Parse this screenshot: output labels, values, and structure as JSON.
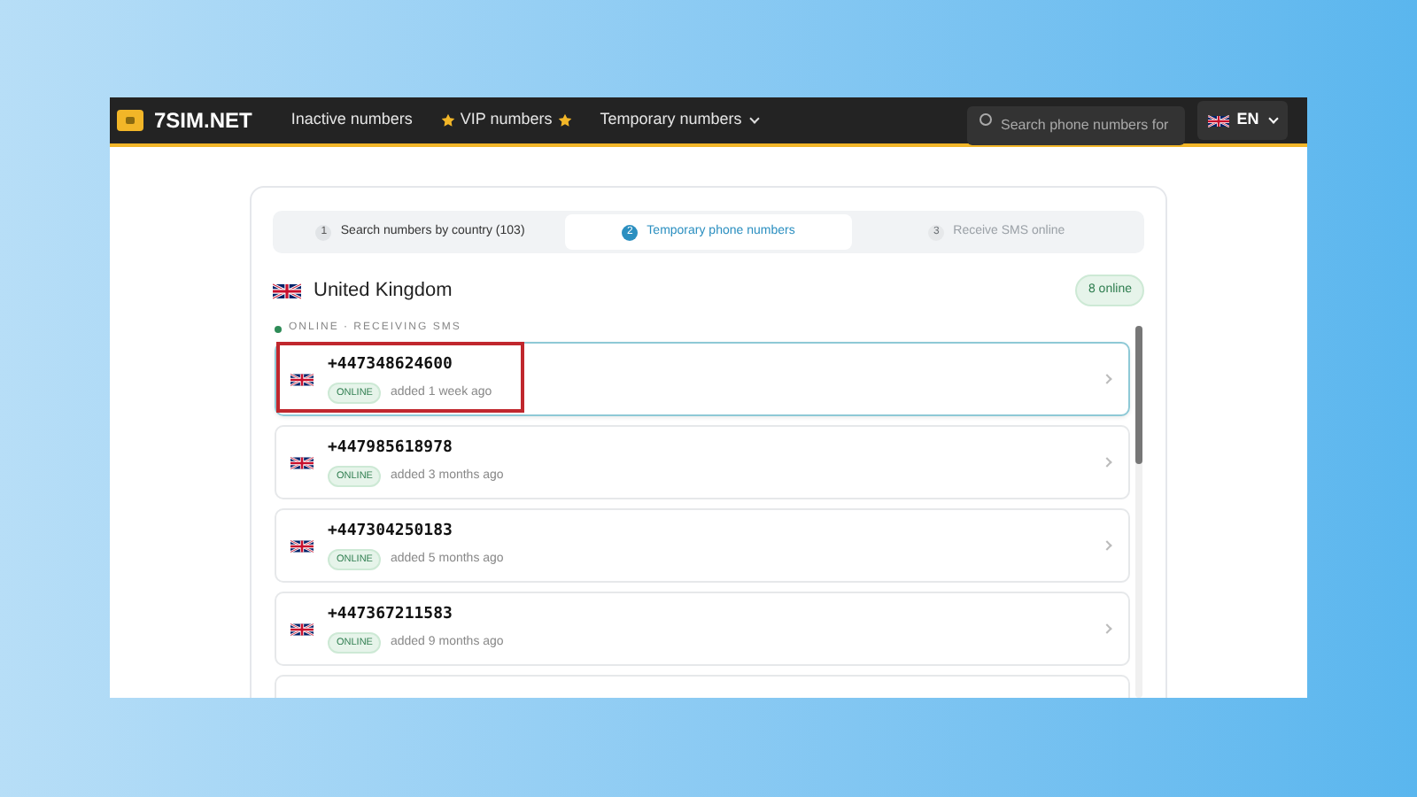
{
  "nav": {
    "logo": "7SIM.NET",
    "items": [
      {
        "label": "Inactive numbers",
        "kind": "plain"
      },
      {
        "label": "VIP numbers",
        "kind": "starred"
      },
      {
        "label": "Temporary numbers",
        "kind": "dropdown"
      }
    ],
    "search": {
      "placeholder": "Search phone numbers for"
    },
    "language": "EN"
  },
  "steps": [
    {
      "number": "1",
      "label": "Search numbers by country (103)",
      "selected": false,
      "disabled": false
    },
    {
      "number": "2",
      "label": "Temporary phone numbers",
      "selected": true,
      "disabled": false
    },
    {
      "number": "3",
      "label": "Receive SMS online",
      "selected": false,
      "disabled": true
    }
  ],
  "country": {
    "name": "United Kingdom",
    "badge": "8 online"
  },
  "section_label": "ONLINE · RECEIVING SMS",
  "numbers": [
    {
      "phone": "+447348624600",
      "status": "ONLINE",
      "added": "added 1 week ago",
      "selected": true,
      "annotated": true
    },
    {
      "phone": "+447985618978",
      "status": "ONLINE",
      "added": "added 3 months ago",
      "selected": false,
      "annotated": false
    },
    {
      "phone": "+447304250183",
      "status": "ONLINE",
      "added": "added 5 months ago",
      "selected": false,
      "annotated": false
    },
    {
      "phone": "+447367211583",
      "status": "ONLINE",
      "added": "added 9 months ago",
      "selected": false,
      "annotated": false
    }
  ]
}
